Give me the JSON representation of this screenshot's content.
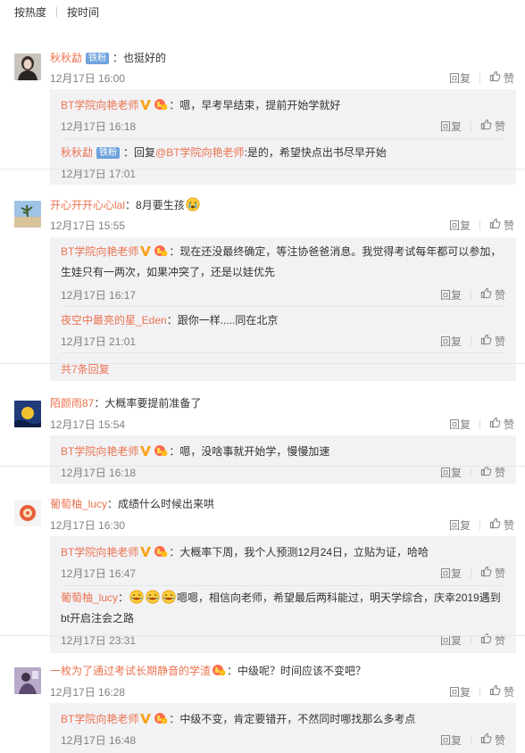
{
  "sort": {
    "hot": "按热度",
    "time": "按时间"
  },
  "labels": {
    "reply": "回复",
    "like": "赞"
  },
  "colors": {
    "name": "#eb7350",
    "reply_bg": "#f2f2f5",
    "muted": "#808080"
  },
  "c1": {
    "name": "秋秋勐",
    "badge": "铁粉",
    "text": "：也挺好的",
    "time": "12月17日 16:00",
    "r1": {
      "name": "BT学院向艳老师",
      "text": "：嗯，早考早结束，提前开始学就好",
      "time": "12月17日 16:18"
    },
    "r2": {
      "name": "秋秋勐",
      "badge": "铁粉",
      "prefix": "：回复",
      "mention": "@BT学院向艳老师",
      "text": ":是的，希望快点出书尽早开始",
      "time": "12月17日 17:01"
    }
  },
  "c2": {
    "name": "开心开开心心lal",
    "text": "：8月要生孩",
    "time": "12月17日 15:55",
    "r1": {
      "name": "BT学院向艳老师",
      "text1": "：现在还没最终确定，等注协爸爸消息。我觉得考试每年都可以参加，",
      "text2": "生娃只有一两次，如果冲突了，还是以娃优先",
      "time": "12月17日 16:17"
    },
    "r2": {
      "name": "夜空中最亮的星_Eden",
      "text": "：跟你一样.....同在北京",
      "time": "12月17日 21:01"
    },
    "more": "共7条回复"
  },
  "c3": {
    "name": "陌颜雨87",
    "text": "：大概率要提前准备了",
    "time": "12月17日 15:54",
    "r1": {
      "name": "BT学院向艳老师",
      "text": "：嗯，没啥事就开始学，慢慢加速",
      "time": "12月17日 16:18"
    }
  },
  "c4": {
    "name": "葡萄柚_lucy",
    "text": "：成绩什么时候出来哄",
    "time": "12月17日 16:30",
    "r1": {
      "name": "BT学院向艳老师",
      "text": "：大概率下周，我个人预测12月24日，立贴为证，哈哈",
      "time": "12月17日 16:47"
    },
    "r2": {
      "name": "葡萄柚_lucy",
      "text1": "嗯嗯，相信向老师，希望最后两科能过，明天学综合，庆幸2019遇到",
      "text2": "bt开启注会之路",
      "time": "12月17日 23:31"
    }
  },
  "c5": {
    "name": "一枚为了通过考试长期静音的学渣",
    "text": "：中级呢？时间应该不变吧？",
    "time": "12月17日 16:28",
    "r1": {
      "name": "BT学院向艳老师",
      "text": "：中级不变，肯定要错开，不然同时哪找那么多考点",
      "time": "12月17日 16:48"
    }
  }
}
